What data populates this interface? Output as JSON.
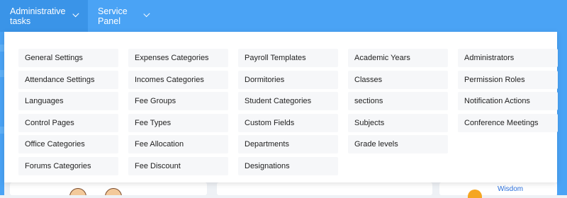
{
  "nav": {
    "admin_tasks": "Administrative tasks",
    "service_panel": "Service Panel"
  },
  "menu": {
    "col1": [
      "General Settings",
      "Attendance Settings",
      "Languages",
      "Control Pages",
      "Office Categories",
      "Forums Categories"
    ],
    "col2": [
      "Expenses Categories",
      "Incomes Categories",
      "Fee Groups",
      "Fee Types",
      "Fee Allocation",
      "Fee Discount"
    ],
    "col3": [
      "Payroll Templates",
      "Dormitories",
      "Student Categories",
      "Custom Fields",
      "Departments",
      "Designations"
    ],
    "col4": [
      "Academic Years",
      "Classes",
      "sections",
      "Subjects",
      "Grade levels"
    ],
    "col5": [
      "Administrators",
      "Permission Roles",
      "Notification Actions",
      "Conference Meetings"
    ]
  },
  "background": {
    "partial_text": "Wisdom"
  },
  "colors": {
    "topbar": "#4aa3f5",
    "item_bg": "#f6f7f9"
  }
}
